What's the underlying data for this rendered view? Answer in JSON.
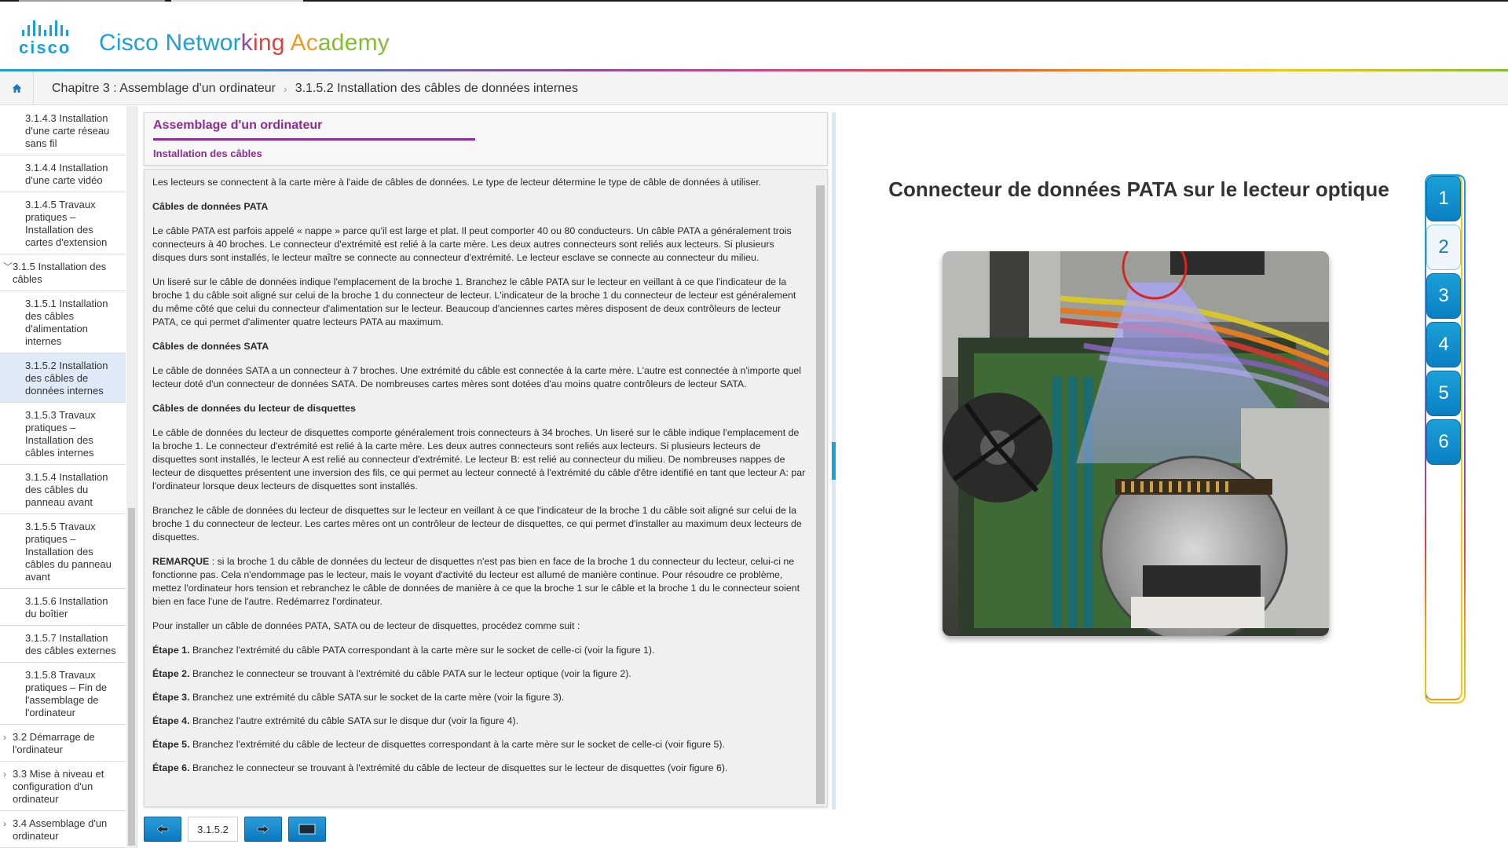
{
  "header": {
    "logo_text": "cisco",
    "brand": {
      "part1": "Cisco Networ",
      "part2": "k",
      "part3": "ing",
      "part4": " Ac",
      "part5": "ademy"
    }
  },
  "breadcrumb": {
    "chapter": "Chapitre 3 : Assemblage d'un ordinateur",
    "page": "3.1.5.2 Installation des câbles de données internes"
  },
  "sidebar": {
    "items": [
      {
        "label": "3.1.4.3 Installation d'une carte réseau sans fil",
        "level": 3
      },
      {
        "label": "3.1.4.4 Installation d'une carte vidéo",
        "level": 3
      },
      {
        "label": "3.1.4.5 Travaux pratiques – Installation des cartes d'extension",
        "level": 3
      },
      {
        "label": "3.1.5 Installation des câbles",
        "level": 2,
        "chevron": "﹀"
      },
      {
        "label": "3.1.5.1 Installation des câbles d'alimentation internes",
        "level": 3
      },
      {
        "label": "3.1.5.2 Installation des câbles de données internes",
        "level": 3,
        "active": true
      },
      {
        "label": "3.1.5.3 Travaux pratiques – Installation des câbles internes",
        "level": 3
      },
      {
        "label": "3.1.5.4 Installation des câbles du panneau avant",
        "level": 3
      },
      {
        "label": "3.1.5.5 Travaux pratiques – Installation des câbles du panneau avant",
        "level": 3
      },
      {
        "label": "3.1.5.6 Installation du boîtier",
        "level": 3
      },
      {
        "label": "3.1.5.7 Installation des câbles externes",
        "level": 3
      },
      {
        "label": "3.1.5.8 Travaux pratiques – Fin de l'assemblage de l'ordinateur",
        "level": 3
      },
      {
        "label": "3.2 Démarrage de l'ordinateur",
        "level": 2,
        "chevron": "›"
      },
      {
        "label": "3.3 Mise à niveau et configuration d'un ordinateur",
        "level": 2,
        "chevron": "›"
      },
      {
        "label": "3.4 Assemblage d'un ordinateur",
        "level": 2,
        "chevron": "›"
      }
    ]
  },
  "content": {
    "title": "Assemblage d'un ordinateur",
    "subtitle": "Installation des câbles",
    "intro": "Les lecteurs se connectent à la carte mère à l'aide de câbles de données. Le type de lecteur détermine le type de câble de données à utiliser.",
    "pata_heading": "Câbles de données PATA",
    "pata_p1": "Le câble PATA est parfois appelé « nappe » parce qu'il est large et plat. Il peut comporter 40 ou 80 conducteurs. Un câble PATA a généralement trois connecteurs à 40 broches. Le connecteur d'extrémité est relié à la carte mère. Les deux autres connecteurs sont reliés aux lecteurs. Si plusieurs disques durs sont installés, le lecteur maître se connecte au connecteur d'extrémité. Le lecteur esclave se connecte au connecteur du milieu.",
    "pata_p2": "Un liseré sur le câble de données indique l'emplacement de la broche 1. Branchez le câble PATA sur le lecteur en veillant à ce que l'indicateur de la broche 1 du câble soit aligné sur celui de la broche 1 du connecteur de lecteur. L'indicateur de la broche 1 du connecteur de lecteur est généralement du même côté que celui du connecteur d'alimentation sur le lecteur. Beaucoup d'anciennes cartes mères disposent de deux contrôleurs de lecteur PATA, ce qui permet d'alimenter quatre lecteurs PATA au maximum.",
    "sata_heading": "Câbles de données SATA",
    "sata_p1": "Le câble de données SATA a un connecteur à 7 broches. Une extrémité du câble est connectée à la carte mère. L'autre est connectée à n'importe quel lecteur doté d'un connecteur de données SATA. De nombreuses cartes mères sont dotées d'au moins quatre contrôleurs de lecteur SATA.",
    "floppy_heading": "Câbles de données du lecteur de disquettes",
    "floppy_p1": "Le câble de données du lecteur de disquettes comporte généralement trois connecteurs à 34 broches. Un liseré sur le câble indique l'emplacement de la broche 1. Le connecteur d'extrémité est relié à la carte mère. Les deux autres connecteurs sont reliés aux lecteurs. Si plusieurs lecteurs de disquettes sont installés, le lecteur A est relié au connecteur d'extrémité. Le lecteur B: est relié au connecteur du milieu. De nombreuses nappes de lecteur de disquettes présentent une inversion des fils, ce qui permet au lecteur connecté à l'extrémité du câble d'être identifié en tant que lecteur A: par l'ordinateur lorsque deux lecteurs de disquettes sont installés.",
    "floppy_p2": "Branchez le câble de données du lecteur de disquettes sur le lecteur en veillant à ce que l'indicateur de la broche 1 du câble soit aligné sur celui de la broche 1 du connecteur de lecteur. Les cartes mères ont un contrôleur de lecteur de disquettes, ce qui permet d'installer au maximum deux lecteurs de disquettes.",
    "note_label": "REMARQUE",
    "note_text": " : si la broche 1 du câble de données du lecteur de disquettes n'est pas bien en face de la broche 1 du connecteur du lecteur, celui-ci ne fonctionne pas. Cela n'endommage pas le lecteur, mais le voyant d'activité du lecteur est allumé de manière continue. Pour résoudre ce problème, mettez l'ordinateur hors tension et rebranchez le câble de données de manière à ce que la broche 1 sur le câble et la broche 1 du le connecteur soient bien en face l'une de l'autre. Redémarrez l'ordinateur.",
    "steps_intro": "Pour installer un câble de données PATA, SATA ou de lecteur de disquettes, procédez comme suit :",
    "steps": [
      {
        "label": "Étape 1.",
        "text": " Branchez l'extrémité du câble PATA correspondant à la carte mère sur le socket de celle-ci (voir la figure 1)."
      },
      {
        "label": "Étape 2.",
        "text": " Branchez le connecteur se trouvant à l'extrémité du câble PATA sur le lecteur optique (voir la figure 2)."
      },
      {
        "label": "Étape 3.",
        "text": " Branchez une extrémité du câble SATA sur le socket de la carte mère (voir la figure 3)."
      },
      {
        "label": "Étape 4.",
        "text": " Branchez l'autre extrémité du câble SATA sur le disque dur (voir la figure 4)."
      },
      {
        "label": "Étape 5.",
        "text": " Branchez l'extrémité du câble de lecteur de disquettes correspondant à la carte mère sur le socket de celle-ci (voir figure 5)."
      },
      {
        "label": "Étape 6.",
        "text": " Branchez le connecteur se trouvant à l'extrémité du câble de lecteur de disquettes sur le lecteur de disquettes (voir figure 6)."
      }
    ]
  },
  "nav": {
    "page_number": "3.1.5.2"
  },
  "figure": {
    "title": "Connecteur de données PATA sur le lecteur optique",
    "tabs": [
      "1",
      "2",
      "3",
      "4",
      "5",
      "6"
    ],
    "active_tab": "2"
  },
  "colors": {
    "brand_blue": "#1ba0d7",
    "heading_purple": "#8d2c94",
    "active_item_bg": "#dfeaf6"
  }
}
